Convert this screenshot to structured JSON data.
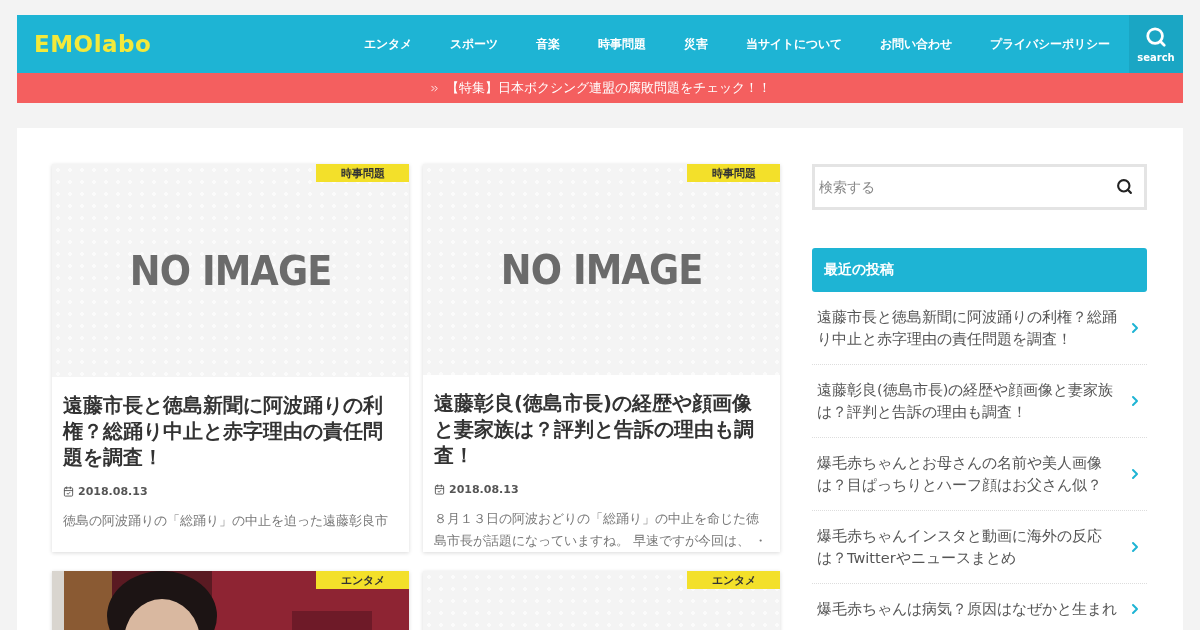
{
  "header": {
    "logo": "EMOlabo",
    "nav": [
      "エンタメ",
      "スポーツ",
      "音楽",
      "時事問題",
      "災害",
      "当サイトについて",
      "お問い合わせ",
      "プライバシーポリシー"
    ],
    "search_label": "search"
  },
  "notice": {
    "text": "【特集】日本ボクシング連盟の腐敗問題をチェック！！"
  },
  "posts": [
    {
      "category": "時事問題",
      "image": {
        "kind": "no-image",
        "text": "NO IMAGE"
      },
      "title": "遠藤市長と徳島新聞に阿波踊りの利権？総踊り中止と赤字理由の責任問題を調査！",
      "date": "2018.08.13",
      "excerpt": "徳島の阿波踊りの「総踊り」の中止を迫った遠藤彰良市"
    },
    {
      "category": "時事問題",
      "image": {
        "kind": "no-image",
        "text": "NO IMAGE"
      },
      "title": "遠藤彰良(徳島市長)の経歴や顔画像と妻家族は？評判と告訴の理由も調査！",
      "date": "2018.08.13",
      "excerpt": "８月１３日の阿波おどりの「総踊り」の中止を命じた徳島市長が話題になっていますね。 早速ですが今回は、 ・"
    },
    {
      "category": "エンタメ"
    },
    {
      "category": "エンタメ",
      "image": {
        "kind": "no-image"
      }
    }
  ],
  "sidebar": {
    "search": {
      "placeholder": "検索する"
    },
    "widget_title": "最近の投稿",
    "recent": [
      "遠藤市長と徳島新聞に阿波踊りの利権？総踊り中止と赤字理由の責任問題を調査！",
      "遠藤彰良(徳島市長)の経歴や顔画像と妻家族は？評判と告訴の理由も調査！",
      "爆毛赤ちゃんとお母さんの名前や美人画像は？目ぱっちりとハーフ顔はお父さん似？",
      "爆毛赤ちゃんインスタと動画に海外の反応は？Twitterやニュースまとめ",
      "爆毛赤ちゃんは病気？原因はなぜかと生まれ"
    ]
  }
}
